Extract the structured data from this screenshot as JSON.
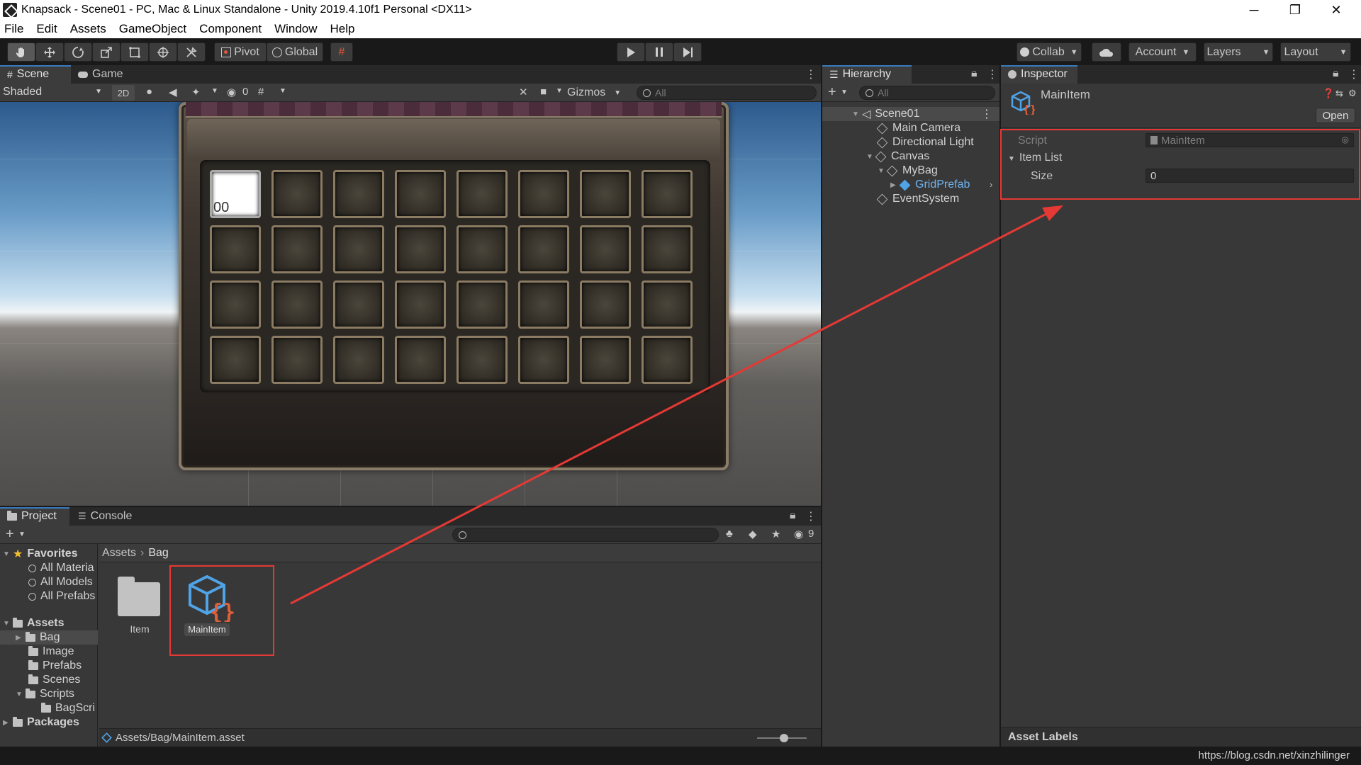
{
  "window": {
    "title": "Knapsack - Scene01 - PC, Mac & Linux Standalone - Unity 2019.4.10f1 Personal <DX11>",
    "minimize": "─",
    "maximize": "❐",
    "close": "✕"
  },
  "menu": [
    "File",
    "Edit",
    "Assets",
    "GameObject",
    "Component",
    "Window",
    "Help"
  ],
  "toolbar": {
    "pivot": "Pivot",
    "global": "Global",
    "collab": "Collab",
    "account": "Account",
    "layers": "Layers",
    "layout": "Layout"
  },
  "scene": {
    "tabs": [
      "Scene",
      "Game"
    ],
    "shading": "Shaded",
    "mode2d": "2D",
    "hidden_count": "0",
    "gizmos": "Gizmos",
    "search_placeholder": "All",
    "first_slot_count": "00"
  },
  "hierarchy": {
    "tab": "Hierarchy",
    "search_placeholder": "All",
    "scene": "Scene01",
    "items": [
      "Main Camera",
      "Directional Light",
      "Canvas",
      "MyBag",
      "GridPrefab",
      "EventSystem"
    ]
  },
  "inspector": {
    "tab": "Inspector",
    "object_name": "MainItem",
    "open_button": "Open",
    "script_label": "Script",
    "script_value": "MainItem",
    "item_list_label": "Item List",
    "size_label": "Size",
    "size_value": "0",
    "asset_labels": "Asset Labels"
  },
  "project": {
    "tabs": [
      "Project",
      "Console"
    ],
    "hidden_count": "9",
    "favorites_label": "Favorites",
    "favorites": [
      "All Materia",
      "All Models",
      "All Prefabs"
    ],
    "assets_label": "Assets",
    "assets_tree": [
      "Bag",
      "Image",
      "Prefabs",
      "Scenes",
      "Scripts",
      "BagScri"
    ],
    "packages_label": "Packages",
    "breadcrumb": [
      "Assets",
      "Bag"
    ],
    "grid_items": [
      "Item",
      "MainItem"
    ],
    "status_path": "Assets/Bag/MainItem.asset"
  },
  "watermark": "https://blog.csdn.net/xinzhilinger",
  "colors": {
    "accent": "#3a79bb",
    "annotation": "#e53935",
    "prefab_blue": "#4fa3e6"
  }
}
